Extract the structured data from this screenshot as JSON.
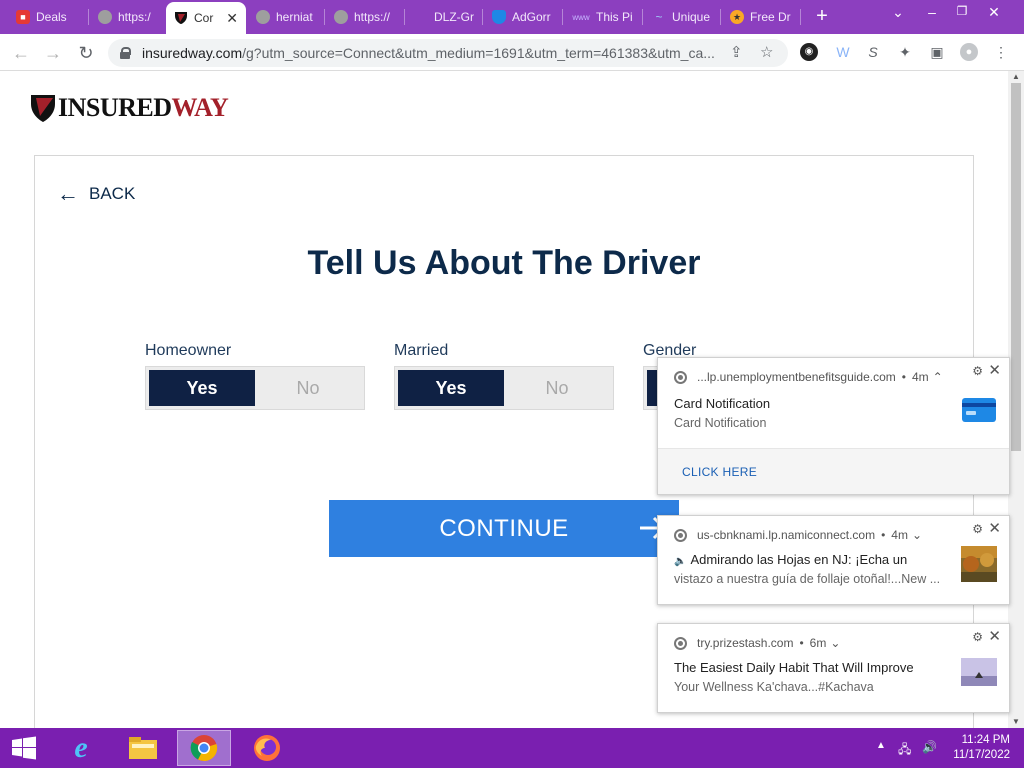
{
  "browser": {
    "tabs": [
      {
        "label": "Deals",
        "icon": "red-bag-icon",
        "color": "#e53935"
      },
      {
        "label": "https:/",
        "icon": "globe-icon",
        "color": "#9e9e9e"
      },
      {
        "label": "Cor",
        "icon": "insuredway-shield-icon",
        "color": "#111111",
        "active": true
      },
      {
        "label": "herniat",
        "icon": "globe-icon",
        "color": "#9e9e9e"
      },
      {
        "label": "https://",
        "icon": "globe-icon",
        "color": "#9e9e9e"
      },
      {
        "label": "DLZ-Gr",
        "icon": "blank-icon",
        "color": "#8c3fbf"
      },
      {
        "label": "AdGorr",
        "icon": "blue-shield-icon",
        "color": "#1e88e5"
      },
      {
        "label": "This Pi",
        "icon": "word-logo-icon",
        "color": "#6a5acd"
      },
      {
        "label": "Unique",
        "icon": "swirl-icon",
        "color": "#64b5f6"
      },
      {
        "label": "Free Dr",
        "icon": "yellow-badge-icon",
        "color": "#f9a825"
      }
    ],
    "new_tab": "+",
    "url_host": "insuredway.com",
    "url_rest": "/g?utm_source=Connect&utm_medium=1691&utm_term=461383&utm_ca..."
  },
  "site": {
    "logo_part1": "INSURED",
    "logo_part2": "WAY",
    "back_label": "BACK",
    "heading": "Tell Us About The Driver",
    "fields": [
      {
        "label": "Homeowner",
        "yes": "Yes",
        "no": "No",
        "selected": "yes"
      },
      {
        "label": "Married",
        "yes": "Yes",
        "no": "No",
        "selected": "yes"
      },
      {
        "label": "Gender",
        "yes": "",
        "no": "",
        "selected": "first"
      }
    ],
    "continue_label": "CONTINUE"
  },
  "notifications": [
    {
      "source": "...lp.unemploymentbenefitsguide.com",
      "age": "4m",
      "title": "Card Notification",
      "body": "Card Notification",
      "action": "CLICK HERE",
      "thumb": "credit-card-icon"
    },
    {
      "source": "us-cbnknami.lp.namiconnect.com",
      "age": "4m",
      "title": "Admirando las Hojas en NJ: ¡Echa un",
      "body": "vistazo a nuestra guía de follaje otoñal!...New ...",
      "thumb": "autumn-photo"
    },
    {
      "source": "try.prizestash.com",
      "age": "6m",
      "title": "The Easiest Daily Habit That Will Improve",
      "body": "Your Wellness Ka'chava...#Kachava",
      "thumb": "sunset-photo"
    }
  ],
  "taskbar": {
    "time": "11:24 PM",
    "date": "11/17/2022"
  },
  "colors": {
    "chrome_frame": "#8c3fbf",
    "taskbar": "#7a1fb0",
    "brand_navy": "#0d2a4a",
    "brand_red": "#a3202a",
    "continue_blue": "#2f80e0",
    "toggle_on": "#0f2144"
  }
}
